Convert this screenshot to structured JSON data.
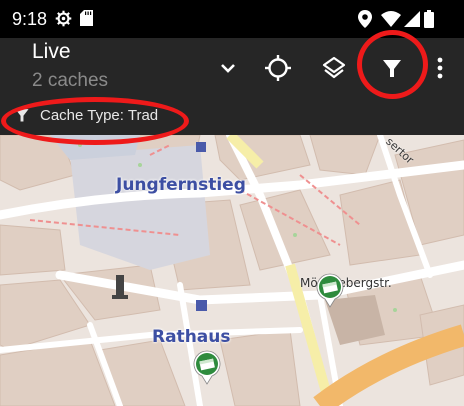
{
  "status_bar": {
    "time": "9:18",
    "icons": [
      "settings-gear-icon",
      "sd-card-icon",
      "location-icon",
      "wifi-icon",
      "signal-icon",
      "battery-icon"
    ]
  },
  "app_bar": {
    "title": "Live",
    "subtitle": "2 caches",
    "actions": [
      "dropdown-chevron-icon",
      "my-location-crosshair-icon",
      "map-layers-icon",
      "filter-icon",
      "more-vert-icon"
    ]
  },
  "filter_chip": {
    "label": "Cache Type: Trad",
    "icon": "filter-icon"
  },
  "map": {
    "labels": {
      "jungfernstieg": "Jungfernstieg",
      "rathaus": "Rathaus",
      "moenckeberg": "Mönckebergstr.",
      "kollsetor": "sertor"
    },
    "markers": [
      "traditional-cache-marker",
      "traditional-cache-marker"
    ]
  },
  "colors": {
    "appbar_bg": "#262626",
    "annotation_red": "#ee1a1a",
    "cache_green": "#2e8b3d",
    "map_bg": "#ece4de",
    "label_blue": "#3d4fa3"
  }
}
